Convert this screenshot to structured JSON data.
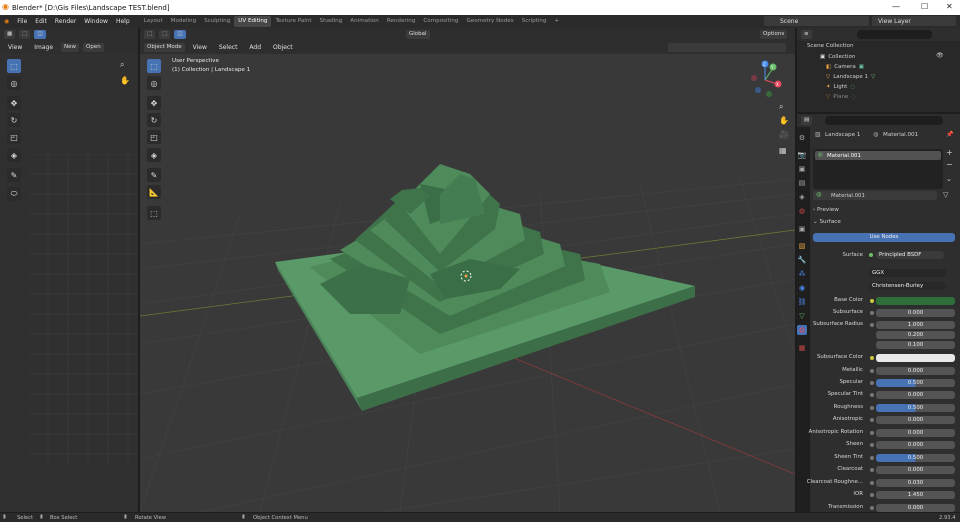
{
  "window": {
    "title": "Blender* [D:\\Gis Files\\Landscape TEST.blend]"
  },
  "menu": [
    "File",
    "Edit",
    "Render",
    "Window",
    "Help"
  ],
  "workspaces": [
    "Layout",
    "Modeling",
    "Sculpting",
    "UV Editing",
    "Texture Paint",
    "Shading",
    "Animation",
    "Rendering",
    "Compositing",
    "Geometry Nodes",
    "Scripting"
  ],
  "active_workspace": "UV Editing",
  "scene": {
    "name": "Scene",
    "view_layer": "View Layer"
  },
  "uv_editor": {
    "menu": [
      "View",
      "Image"
    ],
    "new_label": "New",
    "open_label": "Open"
  },
  "viewport": {
    "mode": "Object Mode",
    "menu": [
      "View",
      "Select",
      "Add",
      "Object"
    ],
    "orientation": "Global",
    "options_label": "Options",
    "overlay_title": "User Perspective",
    "overlay_subtitle": "(1) Collection | Landscape 1",
    "gizmo": {
      "x": "X",
      "y": "Y",
      "z": "Z"
    }
  },
  "outliner": {
    "root": "Scene Collection",
    "items": [
      {
        "name": "Collection"
      },
      {
        "name": "Camera"
      },
      {
        "name": "Landscape 1"
      },
      {
        "name": "Light"
      },
      {
        "name": "Plane"
      }
    ]
  },
  "properties": {
    "object_name": "Landscape 1",
    "material_name_header": "Material.001",
    "slot": "Material.001",
    "datablock": "Material.001",
    "preview_label": "Preview",
    "surface_label": "Surface",
    "use_nodes_label": "Use Nodes",
    "surface_shader_label": "Surface",
    "surface_shader": "Principled BSDF",
    "distribution": "GGX",
    "subsurface_method": "Christensen-Burley",
    "rows": [
      {
        "label": "Base Color",
        "value": "",
        "kind": "color",
        "color": "#2e6e3a"
      },
      {
        "label": "Subsurface",
        "value": "0.000"
      },
      {
        "label": "Subsurface Radius",
        "value": "1.000"
      },
      {
        "label": "",
        "value": "0.200"
      },
      {
        "label": "",
        "value": "0.100"
      },
      {
        "label": "Subsurface Color",
        "value": "",
        "kind": "color",
        "color": "#e8e8e8"
      },
      {
        "label": "Metallic",
        "value": "0.000"
      },
      {
        "label": "Specular",
        "value": "0.500",
        "fill": 0.5
      },
      {
        "label": "Specular Tint",
        "value": "0.000"
      },
      {
        "label": "Roughness",
        "value": "0.500",
        "fill": 0.5
      },
      {
        "label": "Anisotropic",
        "value": "0.000"
      },
      {
        "label": "Anisotropic Rotation",
        "value": "0.000"
      },
      {
        "label": "Sheen",
        "value": "0.000"
      },
      {
        "label": "Sheen Tint",
        "value": "0.500",
        "fill": 0.5
      },
      {
        "label": "Clearcoat",
        "value": "0.000"
      },
      {
        "label": "Clearcoat Roughne...",
        "value": "0.030"
      },
      {
        "label": "IOR",
        "value": "1.450"
      },
      {
        "label": "Transmission",
        "value": "0.000"
      }
    ]
  },
  "status": {
    "select": "Select",
    "box_select": "Box Select",
    "rotate": "Rotate View",
    "context": "Object Context Menu",
    "version": "2.93.4"
  },
  "colors": {
    "accent": "#4772b3",
    "terrain": "#4e8a5a",
    "terrain_dark": "#3a6e46",
    "plane": "#5a9a68"
  }
}
